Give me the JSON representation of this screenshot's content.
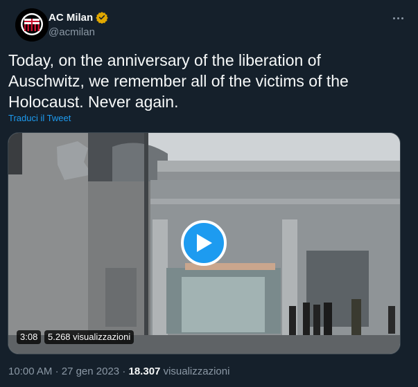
{
  "author": {
    "display_name": "AC Milan",
    "handle": "@acmilan",
    "verified_icon": "verified-badge-icon",
    "badge_color": "#e0a700"
  },
  "tweet": {
    "text": "Today, on the anniversary of the liberation of Auschwitz, we remember all of the victims of the Holocaust. Never again.",
    "translate_label": "Traduci il Tweet"
  },
  "media": {
    "duration": "3:08",
    "views": "5.268 visualizzazioni",
    "play_icon": "play-icon",
    "play_color": "#1d9bf0"
  },
  "footer": {
    "time": "10:00 AM",
    "separator": "·",
    "date": "27 gen 2023",
    "views_count": "18.307",
    "views_label": "visualizzazioni"
  },
  "colors": {
    "background": "#15202b",
    "text": "#f7f9f9",
    "secondary": "#8b98a5",
    "link": "#1d9bf0"
  }
}
